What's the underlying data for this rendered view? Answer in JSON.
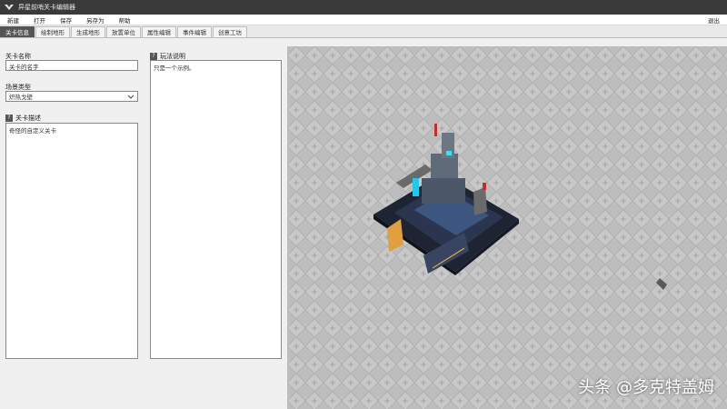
{
  "app": {
    "title": "异星前哨关卡编辑器"
  },
  "menu": {
    "items": [
      "新建",
      "打开",
      "保存",
      "另存为",
      "帮助"
    ],
    "exit_label": "退出"
  },
  "tabs": [
    {
      "label": "关卡信息",
      "active": true
    },
    {
      "label": "绘制地形",
      "active": false
    },
    {
      "label": "生成地形",
      "active": false
    },
    {
      "label": "放置单位",
      "active": false
    },
    {
      "label": "属性编辑",
      "active": false
    },
    {
      "label": "事件编辑",
      "active": false
    },
    {
      "label": "创意工坊",
      "active": false
    }
  ],
  "form": {
    "level_name_label": "关卡名称",
    "level_name_value": "关卡的名字",
    "scene_type_label": "场景类型",
    "scene_type_value": "炽热戈壁",
    "level_desc_label": "关卡描述",
    "level_desc_value": "奇怪的自定义关卡",
    "gameplay_label": "玩法说明",
    "gameplay_value": "只是一个示例。",
    "help_glyph": "?"
  },
  "watermark": "头条 @多克特盖姆",
  "colors": {
    "titlebar": "#3a3a3a",
    "active_tab": "#555555",
    "viewport_floor": "#bdbdbd"
  }
}
